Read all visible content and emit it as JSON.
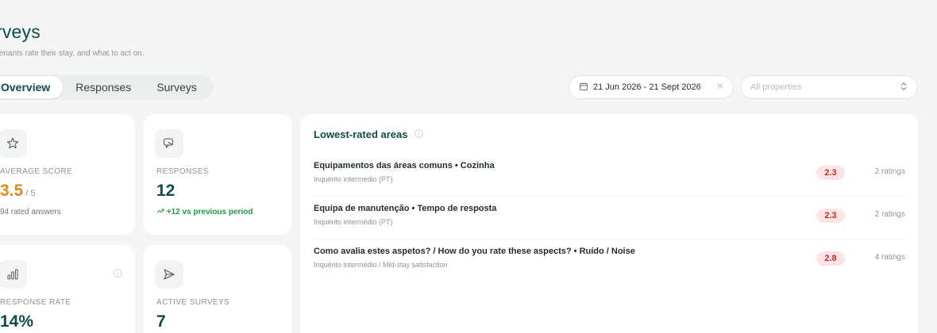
{
  "header": {
    "title": "urveys",
    "subtitle": "w tenants rate their stay, and what to act on."
  },
  "tabs": [
    {
      "label": "Overview",
      "active": true
    },
    {
      "label": "Responses",
      "active": false
    },
    {
      "label": "Surveys",
      "active": false
    }
  ],
  "filters": {
    "date_range": "21 Jun 2026 - 21 Sept 2026",
    "clear_icon": "x-icon",
    "property_placeholder": "All properties"
  },
  "kpis": {
    "average_score": {
      "label": "AVERAGE SCORE",
      "value": "3.5",
      "suffix": "/ 5",
      "note": "94 rated answers",
      "icon": "star-icon"
    },
    "responses": {
      "label": "RESPONSES",
      "value": "12",
      "note": "+12 vs previous period",
      "icon": "chat-icon"
    },
    "response_rate": {
      "label": "RESPONSE RATE",
      "value": "14%",
      "icon": "bar-chart-icon"
    },
    "active_surveys": {
      "label": "ACTIVE SURVEYS",
      "value": "7",
      "icon": "send-icon"
    }
  },
  "lowest_rated": {
    "title": "Lowest-rated areas",
    "items": [
      {
        "title": "Equipamentos das áreas comuns • Cozinha",
        "subtitle": "Inquérito intermédio (PT)",
        "score": "2.3",
        "count": "2 ratings"
      },
      {
        "title": "Equipa de manutenção • Tempo de resposta",
        "subtitle": "Inquérito intermédio (PT)",
        "score": "2.3",
        "count": "2 ratings"
      },
      {
        "title": "Como avalia estes aspetos? / How do you rate these aspects? • Ruído / Noise",
        "subtitle": "Inquérito intermédio / Mid-stay satisfaction",
        "score": "2.8",
        "count": "4 ratings"
      }
    ]
  },
  "colors": {
    "brand": "#0f4c46",
    "accent": "#e08a17",
    "positive": "#1d9a42",
    "danger": "#c22b2b"
  }
}
